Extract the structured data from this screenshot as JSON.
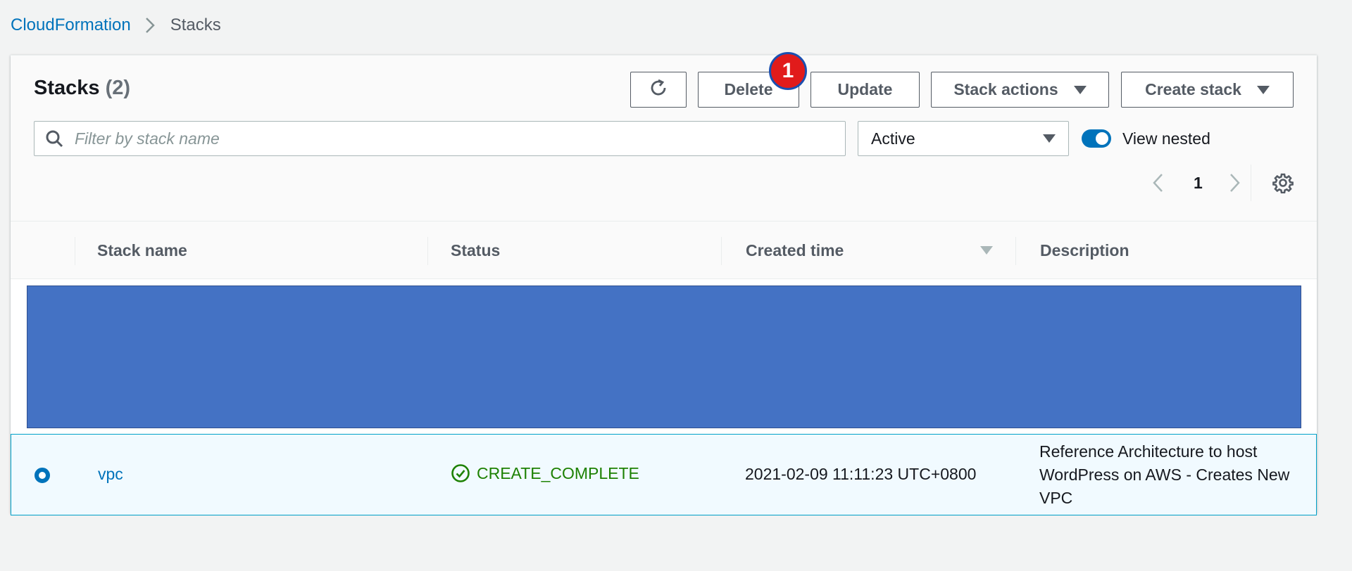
{
  "breadcrumb": {
    "root": "CloudFormation",
    "current": "Stacks"
  },
  "panel": {
    "title": "Stacks",
    "count": "(2)",
    "notification_badge": "1"
  },
  "toolbar": {
    "refresh_icon": "refresh-icon",
    "delete_label": "Delete",
    "update_label": "Update",
    "stack_actions_label": "Stack actions",
    "create_stack_label": "Create stack"
  },
  "filter": {
    "placeholder": "Filter by stack name",
    "value": ""
  },
  "status_filter": {
    "selected": "Active"
  },
  "view_nested": {
    "label": "View nested",
    "enabled": true
  },
  "pagination": {
    "current_page": "1"
  },
  "table": {
    "columns": [
      "Stack name",
      "Status",
      "Created time",
      "Description"
    ],
    "sorted_column": "Created time",
    "rows": [
      {
        "selected": true,
        "name": "vpc",
        "status": "CREATE_COMPLETE",
        "created_time": "2021-02-09 11:11:23 UTC+0800",
        "description": "Reference Architecture to host WordPress on AWS - Creates New VPC"
      }
    ]
  },
  "colors": {
    "link": "#0073bb",
    "success": "#1d8102",
    "selected_row_bg": "#f1faff",
    "redaction": "#4472c4",
    "badge": "#e11b1b"
  }
}
